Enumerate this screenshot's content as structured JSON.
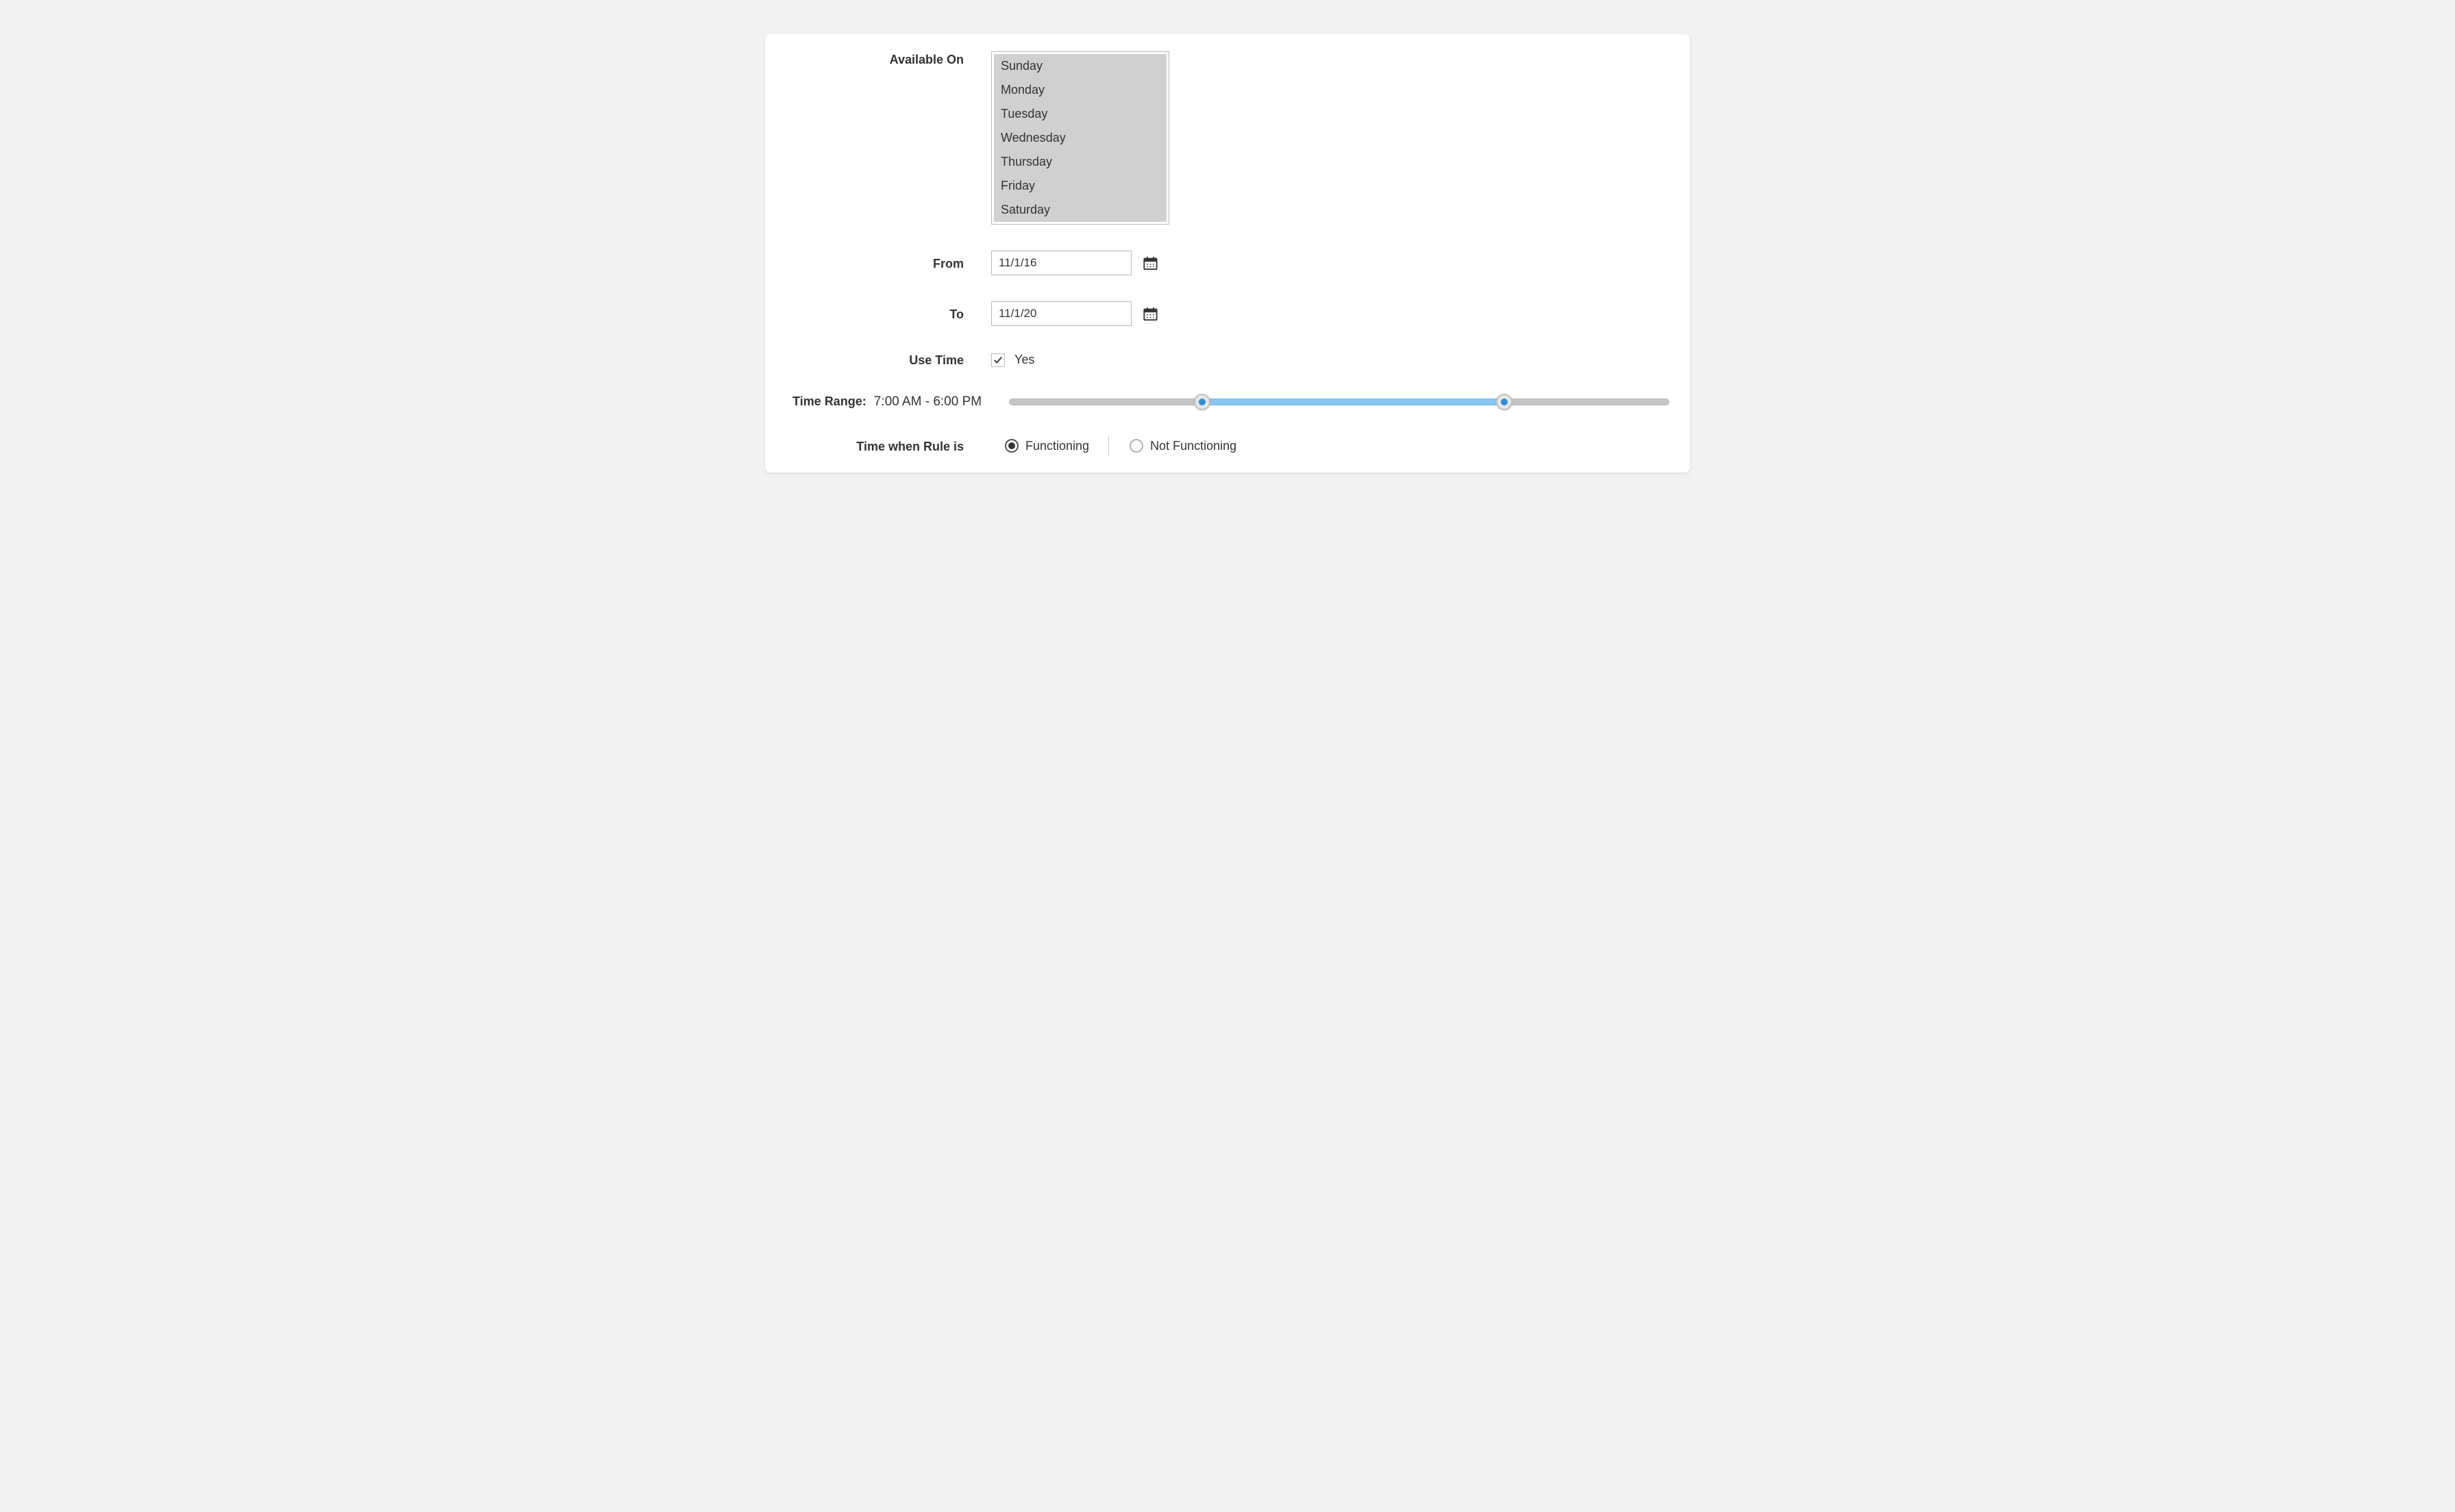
{
  "form": {
    "available_on": {
      "label": "Available On",
      "options": [
        "Sunday",
        "Monday",
        "Tuesday",
        "Wednesday",
        "Thursday",
        "Friday",
        "Saturday"
      ]
    },
    "from": {
      "label": "From",
      "value": "11/1/16"
    },
    "to": {
      "label": "To",
      "value": "11/1/20"
    },
    "use_time": {
      "label": "Use Time",
      "checkbox_label": "Yes",
      "checked": true
    },
    "time_range": {
      "label": "Time Range:",
      "value": "7:00 AM - 6:00 PM"
    },
    "rule_mode": {
      "label": "Time when Rule is",
      "options": {
        "functioning": "Functioning",
        "not_functioning": "Not Functioning"
      },
      "selected": "functioning"
    }
  }
}
